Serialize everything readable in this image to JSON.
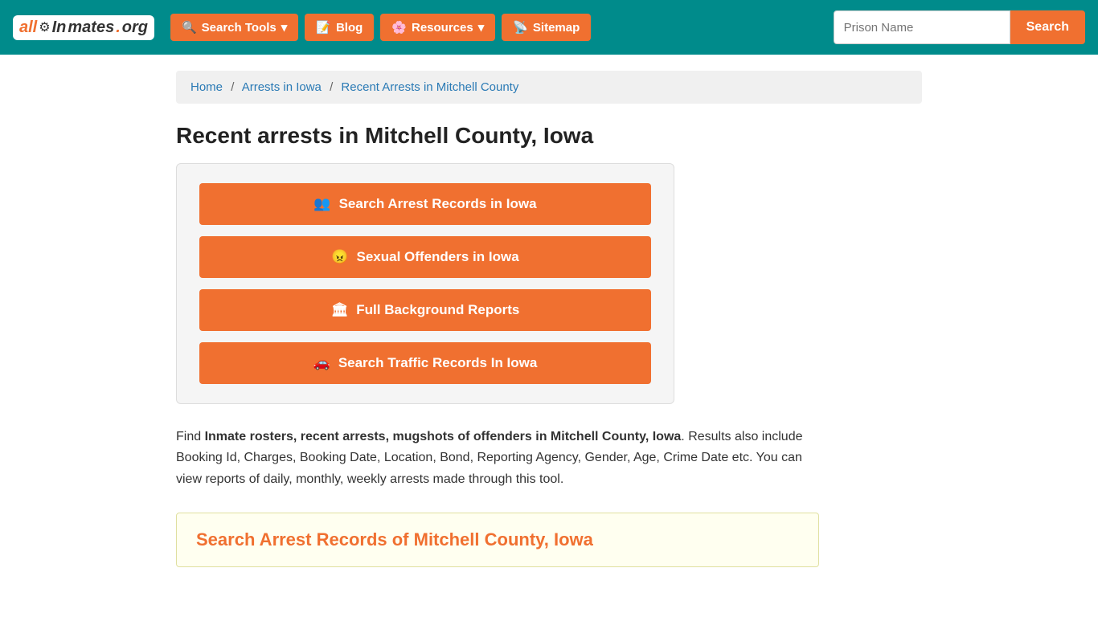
{
  "nav": {
    "logo": {
      "all": "all",
      "in": "In",
      "mates": "mates",
      "dot": ".",
      "org": "org"
    },
    "search_tools_label": "Search Tools",
    "blog_label": "Blog",
    "resources_label": "Resources",
    "sitemap_label": "Sitemap",
    "search_placeholder": "Prison Name",
    "search_btn_label": "Search"
  },
  "breadcrumb": {
    "home": "Home",
    "arrests_iowa": "Arrests in Iowa",
    "current": "Recent Arrests in Mitchell County"
  },
  "page_title": "Recent arrests in Mitchell County, Iowa",
  "buttons": [
    {
      "id": "arrest-records",
      "icon": "👥",
      "label": "Search Arrest Records in Iowa"
    },
    {
      "id": "sexual-offenders",
      "icon": "😠",
      "label": "Sexual Offenders in Iowa"
    },
    {
      "id": "background-reports",
      "icon": "🏛",
      "label": "Full Background Reports"
    },
    {
      "id": "traffic-records",
      "icon": "🚗",
      "label": "Search Traffic Records In Iowa"
    }
  ],
  "description": {
    "intro": "Find ",
    "bold": "Inmate rosters, recent arrests, mugshots of offenders in Mitchell County, Iowa",
    "rest": ". Results also include Booking Id, Charges, Booking Date, Location, Bond, Reporting Agency, Gender, Age, Crime Date etc. You can view reports of daily, monthly, weekly arrests made through this tool."
  },
  "search_section": {
    "title": "Search Arrest Records of Mitchell County, Iowa"
  }
}
